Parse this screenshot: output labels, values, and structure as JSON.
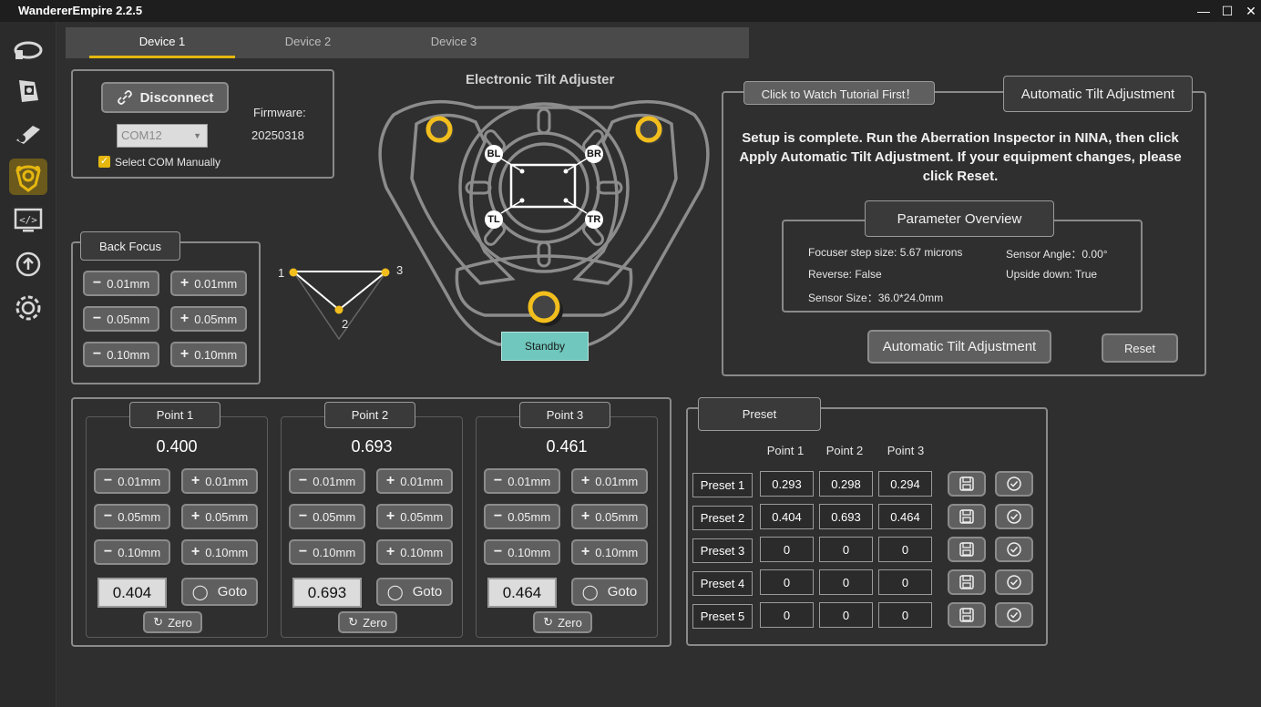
{
  "app": {
    "title": "WandererEmpire 2.2.5"
  },
  "window": {
    "minimize": "—",
    "maximize": "☐",
    "close": "✕"
  },
  "sidebar": {
    "items": [
      {
        "icon": "rotator-icon"
      },
      {
        "icon": "cover-icon"
      },
      {
        "icon": "focuser-icon"
      },
      {
        "icon": "tilt-icon"
      },
      {
        "icon": "console-icon"
      },
      {
        "icon": "update-icon"
      },
      {
        "icon": "settings-icon"
      }
    ]
  },
  "tabs": [
    {
      "label": "Device 1"
    },
    {
      "label": "Device 2"
    },
    {
      "label": "Device 3"
    }
  ],
  "connection": {
    "disconnect_label": "Disconnect",
    "com_port": "COM12",
    "select_com_label": "Select COM Manually",
    "select_com_checked": true,
    "firmware_label": "Firmware:",
    "firmware_value": "20250318"
  },
  "back_focus": {
    "title": "Back Focus",
    "minus": [
      "0.01mm",
      "0.05mm",
      "0.10mm"
    ],
    "plus": [
      "0.01mm",
      "0.05mm",
      "0.10mm"
    ]
  },
  "triangle": {
    "label1": "1",
    "label2": "2",
    "label3": "3"
  },
  "adjuster": {
    "title": "Electronic Tilt Adjuster",
    "corner_bl": "BL",
    "corner_br": "BR",
    "corner_tl": "TL",
    "corner_tr": "TR",
    "status": "Standby",
    "status_color": "#6fc7bd"
  },
  "auto": {
    "tutorial_label": "Click to Watch Tutorial First！",
    "title": "Automatic Tilt Adjustment",
    "message": "Setup is complete. Run the Aberration Inspector in NINA, then click Apply Automatic Tilt Adjustment. If your equipment changes, please click Reset.",
    "params_title": "Parameter Overview",
    "step_size": "Focuser step size: 5.67 microns",
    "reverse": "Reverse: False",
    "sensor_size": "Sensor Size：36.0*24.0mm",
    "sensor_angle": "Sensor Angle：0.00°",
    "upside_down": "Upside down: True",
    "apply_label": "Automatic Tilt Adjustment",
    "reset_label": "Reset"
  },
  "points": [
    {
      "title": "Point 1",
      "value": "0.400",
      "input": "0.404"
    },
    {
      "title": "Point 2",
      "value": "0.693",
      "input": "0.693"
    },
    {
      "title": "Point 3",
      "value": "0.461",
      "input": "0.464"
    }
  ],
  "point_steps": {
    "minus": [
      "0.01mm",
      "0.05mm",
      "0.10mm"
    ],
    "plus": [
      "0.01mm",
      "0.05mm",
      "0.10mm"
    ],
    "goto": "Goto",
    "zero": "Zero"
  },
  "preset": {
    "title": "Preset",
    "headers": [
      "Point 1",
      "Point 2",
      "Point 3"
    ],
    "rows": [
      {
        "name": "Preset 1",
        "values": [
          "0.293",
          "0.298",
          "0.294"
        ]
      },
      {
        "name": "Preset 2",
        "values": [
          "0.404",
          "0.693",
          "0.464"
        ]
      },
      {
        "name": "Preset 3",
        "values": [
          "0",
          "0",
          "0"
        ]
      },
      {
        "name": "Preset 4",
        "values": [
          "0",
          "0",
          "0"
        ]
      },
      {
        "name": "Preset 5",
        "values": [
          "0",
          "0",
          "0"
        ]
      }
    ]
  },
  "colors": {
    "accent": "#e5b70f",
    "panel_border": "#8a8a8a",
    "background": "#2f2f2f"
  }
}
